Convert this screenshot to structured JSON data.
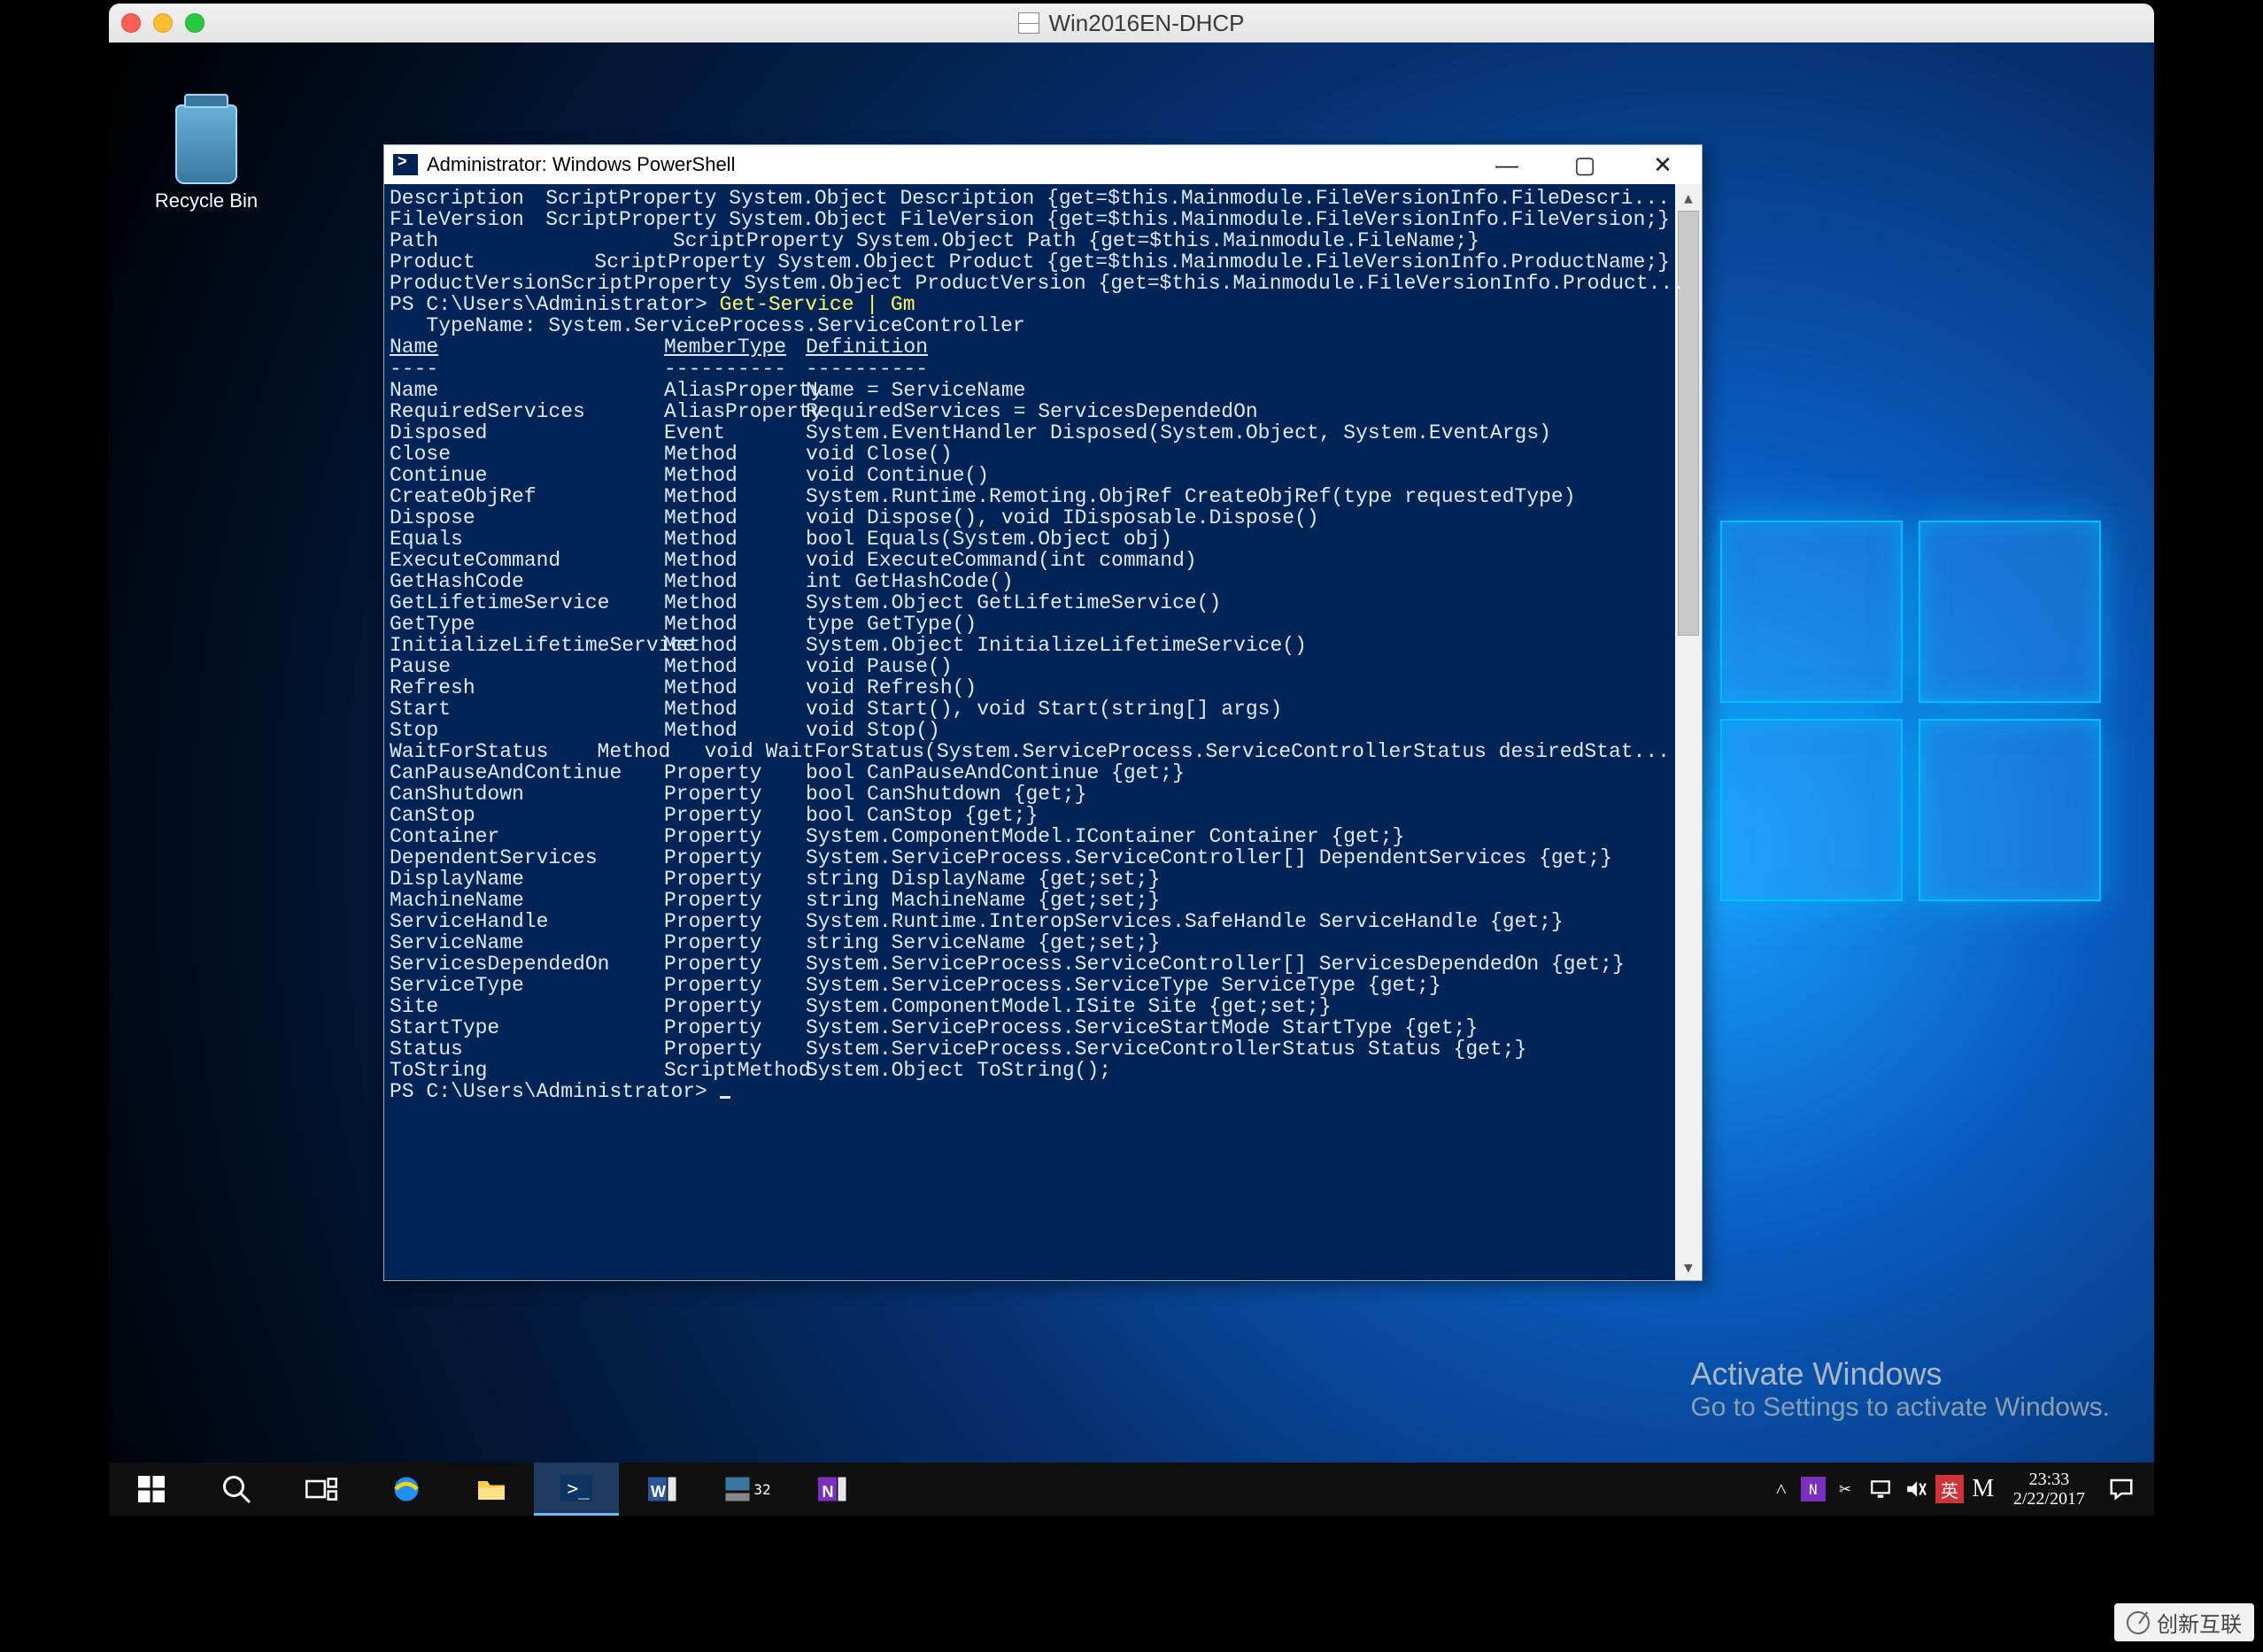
{
  "vm": {
    "title": "Win2016EN-DHCP"
  },
  "desktop": {
    "recycle": "Recycle Bin",
    "activation": {
      "line1": "Activate Windows",
      "line2": "Go to Settings to activate Windows."
    }
  },
  "ps": {
    "title": "Administrator: Windows PowerShell",
    "prompt": "PS C:\\Users\\Administrator> ",
    "cmd_service": "Get-Service | Gm",
    "typename_service": "   TypeName: System.ServiceProcess.ServiceController",
    "headers": {
      "name": "Name",
      "membertype": "MemberType",
      "definition": "Definition"
    },
    "underline": {
      "name": "----",
      "membertype": "----------",
      "definition": "----------"
    },
    "prev_props": [
      {
        "n": "Description",
        "d": "ScriptProperty System.Object Description {get=$this.Mainmodule.FileVersionInfo.FileDescri..."
      },
      {
        "n": "FileVersion",
        "d": "ScriptProperty System.Object FileVersion {get=$this.Mainmodule.FileVersionInfo.FileVersion;}"
      },
      {
        "n": "Path",
        "d": "ScriptProperty System.Object Path {get=$this.Mainmodule.FileName;}"
      },
      {
        "n": "Product",
        "d": "ScriptProperty System.Object Product {get=$this.Mainmodule.FileVersionInfo.ProductName;}"
      },
      {
        "n": "ProductVersion",
        "d": "ScriptProperty System.Object ProductVersion {get=$this.Mainmodule.FileVersionInfo.Product..."
      }
    ],
    "members": [
      {
        "n": "Name",
        "t": "AliasProperty",
        "d": "Name = ServiceName"
      },
      {
        "n": "RequiredServices",
        "t": "AliasProperty",
        "d": "RequiredServices = ServicesDependedOn"
      },
      {
        "n": "Disposed",
        "t": "Event",
        "d": "System.EventHandler Disposed(System.Object, System.EventArgs)"
      },
      {
        "n": "Close",
        "t": "Method",
        "d": "void Close()"
      },
      {
        "n": "Continue",
        "t": "Method",
        "d": "void Continue()"
      },
      {
        "n": "CreateObjRef",
        "t": "Method",
        "d": "System.Runtime.Remoting.ObjRef CreateObjRef(type requestedType)"
      },
      {
        "n": "Dispose",
        "t": "Method",
        "d": "void Dispose(), void IDisposable.Dispose()"
      },
      {
        "n": "Equals",
        "t": "Method",
        "d": "bool Equals(System.Object obj)"
      },
      {
        "n": "ExecuteCommand",
        "t": "Method",
        "d": "void ExecuteCommand(int command)"
      },
      {
        "n": "GetHashCode",
        "t": "Method",
        "d": "int GetHashCode()"
      },
      {
        "n": "GetLifetimeService",
        "t": "Method",
        "d": "System.Object GetLifetimeService()"
      },
      {
        "n": "GetType",
        "t": "Method",
        "d": "type GetType()"
      },
      {
        "n": "InitializeLifetimeService",
        "t": "Method",
        "d": "System.Object InitializeLifetimeService()"
      },
      {
        "n": "Pause",
        "t": "Method",
        "d": "void Pause()"
      },
      {
        "n": "Refresh",
        "t": "Method",
        "d": "void Refresh()"
      },
      {
        "n": "Start",
        "t": "Method",
        "d": "void Start(), void Start(string[] args)"
      },
      {
        "n": "Stop",
        "t": "Method",
        "d": "void Stop()"
      },
      {
        "n": "WaitForStatus",
        "t": "Method",
        "d": "void WaitForStatus(System.ServiceProcess.ServiceControllerStatus desiredStat..."
      },
      {
        "n": "CanPauseAndContinue",
        "t": "Property",
        "d": "bool CanPauseAndContinue {get;}"
      },
      {
        "n": "CanShutdown",
        "t": "Property",
        "d": "bool CanShutdown {get;}"
      },
      {
        "n": "CanStop",
        "t": "Property",
        "d": "bool CanStop {get;}"
      },
      {
        "n": "Container",
        "t": "Property",
        "d": "System.ComponentModel.IContainer Container {get;}"
      },
      {
        "n": "DependentServices",
        "t": "Property",
        "d": "System.ServiceProcess.ServiceController[] DependentServices {get;}"
      },
      {
        "n": "DisplayName",
        "t": "Property",
        "d": "string DisplayName {get;set;}"
      },
      {
        "n": "MachineName",
        "t": "Property",
        "d": "string MachineName {get;set;}"
      },
      {
        "n": "ServiceHandle",
        "t": "Property",
        "d": "System.Runtime.InteropServices.SafeHandle ServiceHandle {get;}"
      },
      {
        "n": "ServiceName",
        "t": "Property",
        "d": "string ServiceName {get;set;}"
      },
      {
        "n": "ServicesDependedOn",
        "t": "Property",
        "d": "System.ServiceProcess.ServiceController[] ServicesDependedOn {get;}"
      },
      {
        "n": "ServiceType",
        "t": "Property",
        "d": "System.ServiceProcess.ServiceType ServiceType {get;}"
      },
      {
        "n": "Site",
        "t": "Property",
        "d": "System.ComponentModel.ISite Site {get;set;}"
      },
      {
        "n": "StartType",
        "t": "Property",
        "d": "System.ServiceProcess.ServiceStartMode StartType {get;}"
      },
      {
        "n": "Status",
        "t": "Property",
        "d": "System.ServiceProcess.ServiceControllerStatus Status {get;}"
      },
      {
        "n": "ToString",
        "t": "ScriptMethod",
        "d": "System.Object ToString();"
      }
    ]
  },
  "taskbar": {
    "time": "23:33",
    "date": "2/22/2017",
    "ime_lang": "英",
    "ime_mode": "M"
  },
  "watermark": "创新互联"
}
